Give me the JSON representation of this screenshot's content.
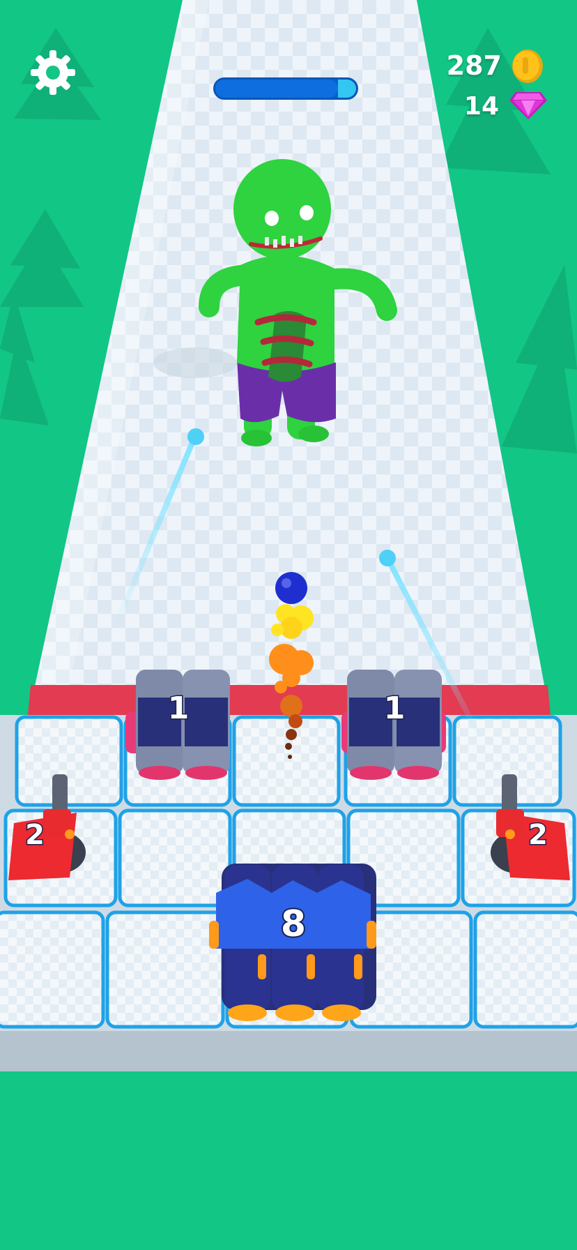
{
  "hud": {
    "coins": "287",
    "gems": "14",
    "boss_health_fraction": 0.87
  },
  "weapons": [
    {
      "id": "cannon-left-top",
      "level": "1"
    },
    {
      "id": "cannon-right-top",
      "level": "1"
    },
    {
      "id": "gun-left",
      "level": "2"
    },
    {
      "id": "gun-right",
      "level": "2"
    },
    {
      "id": "main-cannon",
      "level": "8"
    }
  ],
  "icons": {
    "settings": "gear-icon",
    "currency": "coin-icon",
    "premium": "gem-icon"
  },
  "colors": {
    "background": "#12c685",
    "track": "#e8f1f8",
    "tile_border": "#1ea2e8",
    "boss": "#2fd23f",
    "coin": "#ffc21a",
    "gem": "#e035d6",
    "health_bar": "#0e6ee0"
  }
}
